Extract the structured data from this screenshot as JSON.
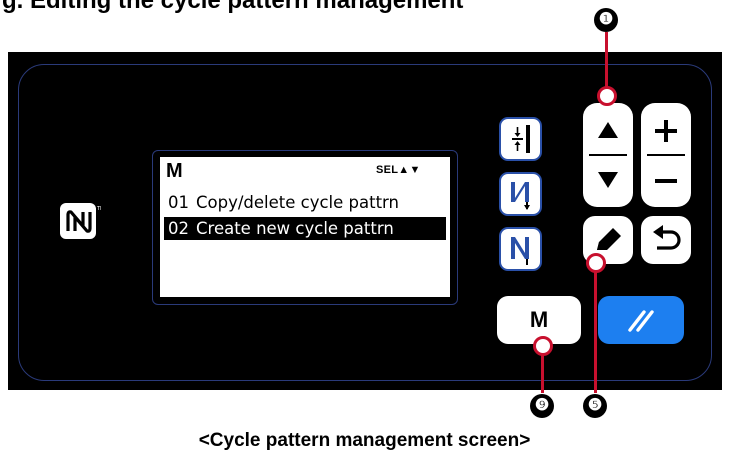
{
  "heading": "g. Editing the cycle pattern management",
  "caption": "<Cycle pattern management screen>",
  "lcd": {
    "mode_label": "M",
    "sel_indicator": "SEL▲▼",
    "items": [
      {
        "no": "01",
        "label": "Copy/delete cycle pattrn",
        "selected": false
      },
      {
        "no": "02",
        "label": "Create new cycle pattrn",
        "selected": true
      }
    ]
  },
  "keys": {
    "m_key": "M",
    "icons": [
      "nfc-icon",
      "presser-foot-icon",
      "thread-clamp-icon",
      "needle-n-icon",
      "up-arrow-icon",
      "down-arrow-icon",
      "plus-icon",
      "minus-icon",
      "edit-pencil-icon",
      "return-icon",
      "clear-slash-icon"
    ]
  },
  "callouts": [
    {
      "id": "1",
      "number": "❶"
    },
    {
      "id": "5",
      "number": "❺"
    },
    {
      "id": "9",
      "number": "❾"
    }
  ],
  "colors": {
    "panel": "#000000",
    "panel_border": "#2a3a7a",
    "key_border": "#2a50a8",
    "clear_key": "#1d7ff0",
    "callout": "#c8102e"
  }
}
